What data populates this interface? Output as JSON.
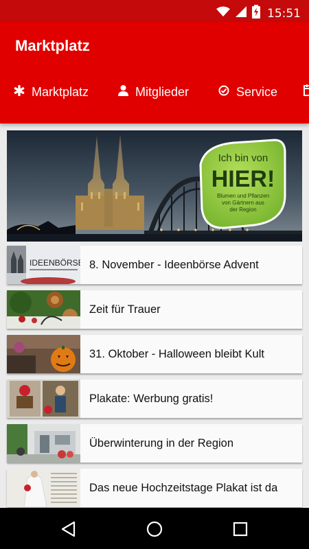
{
  "status_bar": {
    "time": "15:51",
    "icons": [
      "wifi-icon",
      "signal-icon",
      "battery-charging-icon"
    ]
  },
  "app_bar": {
    "title": "Marktplatz",
    "tabs": [
      {
        "label": "Marktplatz",
        "icon": "asterisk-icon"
      },
      {
        "label": "Mitglieder",
        "icon": "person-icon"
      },
      {
        "label": "Service",
        "icon": "check-circle-icon"
      },
      {
        "label": "",
        "icon": "calendar-icon"
      }
    ]
  },
  "hero": {
    "badge_line1": "Ich bin von",
    "badge_line2": "HIER!",
    "badge_line3": "Blumen und Pflanzen",
    "badge_line4": "von Gärtnern aus",
    "badge_line5": "der Region"
  },
  "list": [
    {
      "title": "8. November - Ideenbörse Advent",
      "thumb_text": "IDEENBÖRSE"
    },
    {
      "title": "Zeit für Trauer"
    },
    {
      "title": "31. Oktober - Halloween bleibt Kult"
    },
    {
      "title": "Plakate: Werbung gratis!"
    },
    {
      "title": "Überwinterung in der Region"
    },
    {
      "title": "Das neue Hochzeitstage Plakat ist da"
    }
  ],
  "nav_bar": {
    "buttons": [
      "back-icon",
      "home-icon",
      "recents-icon"
    ]
  },
  "colors": {
    "primary": "#e10000",
    "status_bar": "#c40a0a",
    "badge_green": "#8cc63f"
  }
}
